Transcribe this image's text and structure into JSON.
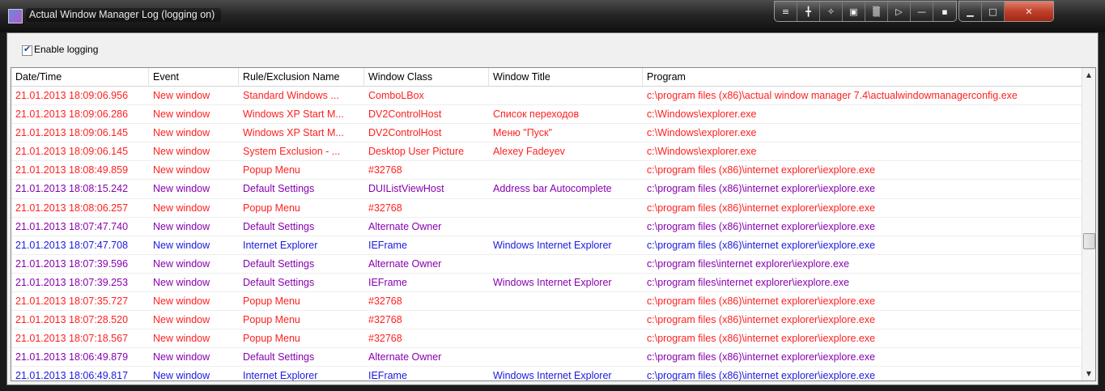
{
  "window": {
    "title": "Actual Window Manager Log (logging on)",
    "icon": "app-icon",
    "titlebar_buttons": [
      "pin-icon",
      "stay-on-top-icon",
      "move-icon",
      "minimize-to-tray-icon",
      "transparency-icon",
      "aero-peek-icon",
      "roll-up-icon",
      "ghost-icon",
      "minimize-icon",
      "maximize-icon",
      "close-icon"
    ]
  },
  "options": {
    "enable_logging_label": "Enable logging",
    "enable_logging_checked": true
  },
  "table": {
    "columns": [
      "Date/Time",
      "Event",
      "Rule/Exclusion Name",
      "Window Class",
      "Window Title",
      "Program"
    ],
    "colors": {
      "red": "#ff2020",
      "purple": "#8800b0",
      "blue": "#1a1ae0"
    },
    "rows": [
      {
        "color": "red",
        "cells": [
          "21.01.2013 18:09:06.956",
          "New window",
          "Standard Windows ...",
          "ComboLBox",
          "",
          "c:\\program files (x86)\\actual window manager 7.4\\actualwindowmanagerconfig.exe"
        ]
      },
      {
        "color": "red",
        "cells": [
          "21.01.2013 18:09:06.286",
          "New window",
          "Windows XP Start M...",
          "DV2ControlHost",
          "Список переходов",
          "c:\\Windows\\explorer.exe"
        ]
      },
      {
        "color": "red",
        "cells": [
          "21.01.2013 18:09:06.145",
          "New window",
          "Windows XP Start M...",
          "DV2ControlHost",
          "Меню \"Пуск\"",
          "c:\\Windows\\explorer.exe"
        ]
      },
      {
        "color": "red",
        "cells": [
          "21.01.2013 18:09:06.145",
          "New window",
          "System Exclusion - ...",
          "Desktop User Picture",
          "Alexey Fadeyev",
          "c:\\Windows\\explorer.exe"
        ]
      },
      {
        "color": "red",
        "cells": [
          "21.01.2013 18:08:49.859",
          "New window",
          "Popup Menu",
          "#32768",
          "",
          "c:\\program files (x86)\\internet explorer\\iexplore.exe"
        ]
      },
      {
        "color": "purple",
        "cells": [
          "21.01.2013 18:08:15.242",
          "New window",
          "Default Settings",
          "DUIListViewHost",
          "Address bar Autocomplete",
          "c:\\program files (x86)\\internet explorer\\iexplore.exe"
        ]
      },
      {
        "color": "red",
        "cells": [
          "21.01.2013 18:08:06.257",
          "New window",
          "Popup Menu",
          "#32768",
          "",
          "c:\\program files (x86)\\internet explorer\\iexplore.exe"
        ]
      },
      {
        "color": "purple",
        "cells": [
          "21.01.2013 18:07:47.740",
          "New window",
          "Default Settings",
          "Alternate Owner",
          "",
          "c:\\program files (x86)\\internet explorer\\iexplore.exe"
        ]
      },
      {
        "color": "blue",
        "cells": [
          "21.01.2013 18:07:47.708",
          "New window",
          "Internet Explorer",
          "IEFrame",
          "Windows Internet Explorer",
          "c:\\program files (x86)\\internet explorer\\iexplore.exe"
        ]
      },
      {
        "color": "purple",
        "cells": [
          "21.01.2013 18:07:39.596",
          "New window",
          "Default Settings",
          "Alternate Owner",
          "",
          "c:\\program files\\internet explorer\\iexplore.exe"
        ]
      },
      {
        "color": "purple",
        "cells": [
          "21.01.2013 18:07:39.253",
          "New window",
          "Default Settings",
          "IEFrame",
          "Windows Internet Explorer",
          "c:\\program files\\internet explorer\\iexplore.exe"
        ]
      },
      {
        "color": "red",
        "cells": [
          "21.01.2013 18:07:35.727",
          "New window",
          "Popup Menu",
          "#32768",
          "",
          "c:\\program files (x86)\\internet explorer\\iexplore.exe"
        ]
      },
      {
        "color": "red",
        "cells": [
          "21.01.2013 18:07:28.520",
          "New window",
          "Popup Menu",
          "#32768",
          "",
          "c:\\program files (x86)\\internet explorer\\iexplore.exe"
        ]
      },
      {
        "color": "red",
        "cells": [
          "21.01.2013 18:07:18.567",
          "New window",
          "Popup Menu",
          "#32768",
          "",
          "c:\\program files (x86)\\internet explorer\\iexplore.exe"
        ]
      },
      {
        "color": "purple",
        "cells": [
          "21.01.2013 18:06:49.879",
          "New window",
          "Default Settings",
          "Alternate Owner",
          "",
          "c:\\program files (x86)\\internet explorer\\iexplore.exe"
        ]
      },
      {
        "color": "blue",
        "cells": [
          "21.01.2013 18:06:49.817",
          "New window",
          "Internet Explorer",
          "IEFrame",
          "Windows Internet Explorer",
          "c:\\program files (x86)\\internet explorer\\iexplore.exe"
        ]
      }
    ]
  }
}
